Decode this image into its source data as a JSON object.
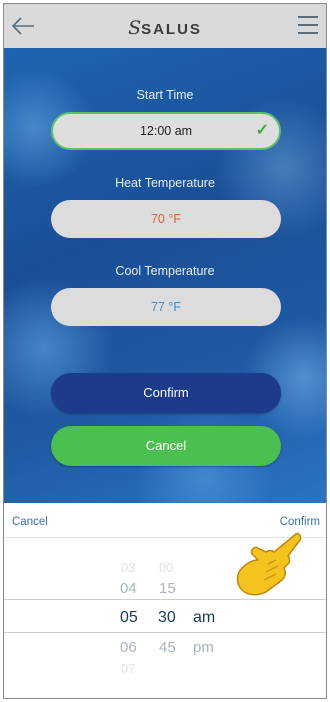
{
  "header": {
    "logo_text": "SALUS",
    "logo_mark": "S"
  },
  "form": {
    "start_time_label": "Start Time",
    "start_time_value": "12:00 am",
    "heat_label": "Heat Temperature",
    "heat_value": "70 °F",
    "cool_label": "Cool Temperature",
    "cool_value": "77 °F",
    "confirm_label": "Confirm",
    "cancel_label": "Cancel"
  },
  "picker": {
    "cancel_label": "Cancel",
    "confirm_label": "Confirm",
    "hours": [
      "03",
      "04",
      "05",
      "06",
      "07"
    ],
    "minutes": [
      "00",
      "15",
      "30",
      "45"
    ],
    "periods": [
      "am",
      "pm"
    ],
    "selected_hour": "05",
    "selected_minute": "30",
    "selected_period": "am"
  },
  "colors": {
    "heat": "#e0603a",
    "cool": "#3a8fd6",
    "confirm_bg": "#1e3a8a",
    "cancel_bg": "#4bbf50",
    "accent": "#3b6fb6"
  }
}
